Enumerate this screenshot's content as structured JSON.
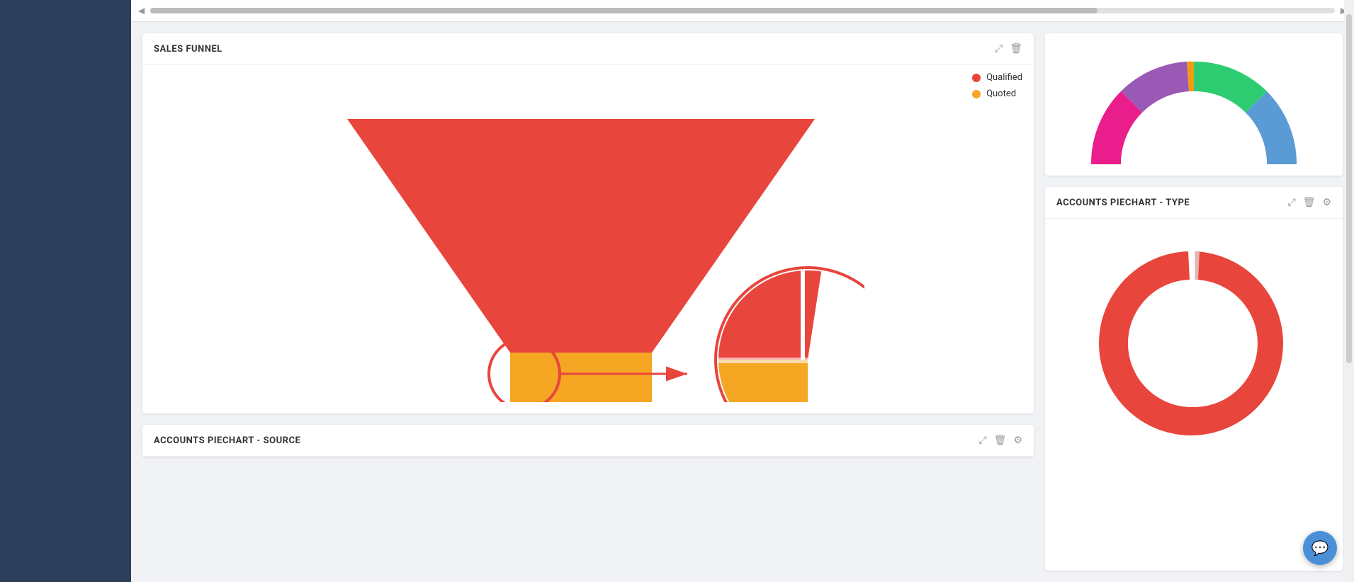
{
  "sidebar": {
    "background": "#2c3e5a"
  },
  "scroll": {
    "left_arrow": "◀",
    "right_arrow": "▶"
  },
  "sales_funnel": {
    "title": "SALES FUNNEL",
    "expand_icon": "⤢",
    "delete_icon": "🗑",
    "legend": [
      {
        "label": "Qualified",
        "color": "#e8453c"
      },
      {
        "label": "Quoted",
        "color": "#f5a623"
      }
    ]
  },
  "donut_top": {
    "title": ""
  },
  "accounts_piechart_type": {
    "title": "ACCOUNTS PIECHART - TYPE",
    "expand_icon": "⤢",
    "delete_icon": "🗑",
    "settings_icon": "⚙"
  },
  "accounts_piechart_source": {
    "title": "ACCOUNTS PIECHART - SOURCE",
    "expand_icon": "⤢",
    "delete_icon": "🗑",
    "settings_icon": "⚙"
  },
  "chat_button": {
    "icon": "💬"
  }
}
